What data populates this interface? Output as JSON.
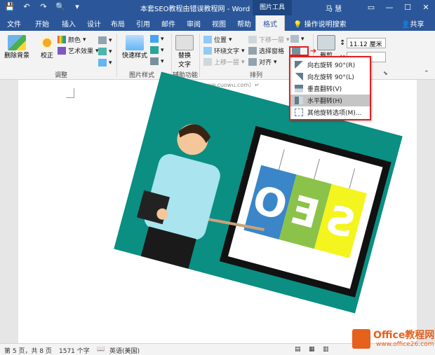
{
  "titlebar": {
    "title": "本套SEO教程由错误教程网 - Word",
    "contextual_tab": "图片工具",
    "user": "马 慧",
    "save_icon": "save-icon",
    "undo_icon": "undo-icon"
  },
  "tabs": [
    "文件",
    "开始",
    "插入",
    "设计",
    "布局",
    "引用",
    "邮件",
    "审阅",
    "视图",
    "帮助",
    "格式"
  ],
  "tell_me": "操作说明搜索",
  "share": "共享",
  "ribbon": {
    "remove_bg": "删除背景",
    "corrections": "校正",
    "color": "颜色",
    "art_effects": "艺术效果",
    "group_adjust": "调整",
    "quick_styles": "快速样式",
    "group_pic_styles": "图片样式",
    "alt_text_line1": "替换",
    "alt_text_line2": "文字",
    "group_access": "辅助功能",
    "position": "位置",
    "wrap_text": "环绕文字",
    "bring_forward": "下移一层",
    "send_backward": "上移一层",
    "selection_pane": "选择窗格",
    "align": "对齐",
    "group_arrange": "排列",
    "crop": "裁剪",
    "height": "11.12 厘米",
    "width": ""
  },
  "rotate_menu": {
    "items": [
      {
        "label": "向右旋转 90°(R)",
        "highlighted": false
      },
      {
        "label": "向左旋转 90°(L)",
        "highlighted": false
      },
      {
        "label": "垂直翻转(V)",
        "highlighted": false
      },
      {
        "label": "水平翻转(H)",
        "highlighted": true
      },
      {
        "label": "其他旋转选项(M)...",
        "highlighted": false
      }
    ]
  },
  "document": {
    "caption": "错误教程（www.cuowu.com）↵"
  },
  "statusbar": {
    "page": "第 5 页，共 8 页",
    "words": "1571 个字",
    "language": "英语(美国)"
  },
  "watermark": {
    "title": "Office教程网",
    "url": "www.office26.com"
  },
  "colors": {
    "word_blue": "#2b579a",
    "highlight_red": "#e02020",
    "teal_bg": "#0a8f82"
  }
}
